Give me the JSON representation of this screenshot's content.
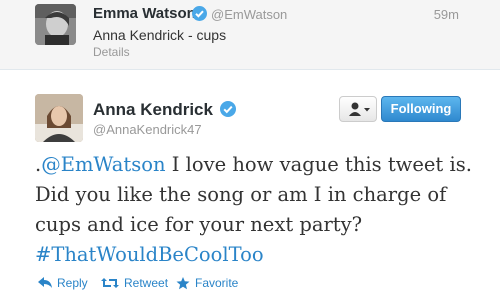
{
  "replied_tweet": {
    "name": "Emma Watson",
    "handle": "@EmWatson",
    "time": "59m",
    "text": "Anna Kendrick - cups",
    "details_label": "Details"
  },
  "tweet": {
    "name": "Anna Kendrick",
    "handle": "@AnnaKendrick47",
    "follow_button_label": "Following",
    "text_prefix": ".",
    "mention": "@EmWatson",
    "text_body": " I love how vague this tweet is. Did you like the song or am I in charge of cups and ice for your next party? ",
    "hashtag": "#ThatWouldBeCoolToo"
  },
  "actions": {
    "reply_label": "Reply",
    "retweet_label": "Retweet",
    "favorite_label": "Favorite"
  },
  "colors": {
    "link": "#2a84c8",
    "verified_badge": "#4aa8e8",
    "follow_button": "#2f89cf"
  },
  "icons": {
    "verified": "verified-badge-icon",
    "user_menu": "person-icon",
    "reply": "reply-arrow-icon",
    "retweet": "retweet-icon",
    "favorite": "star-icon"
  }
}
